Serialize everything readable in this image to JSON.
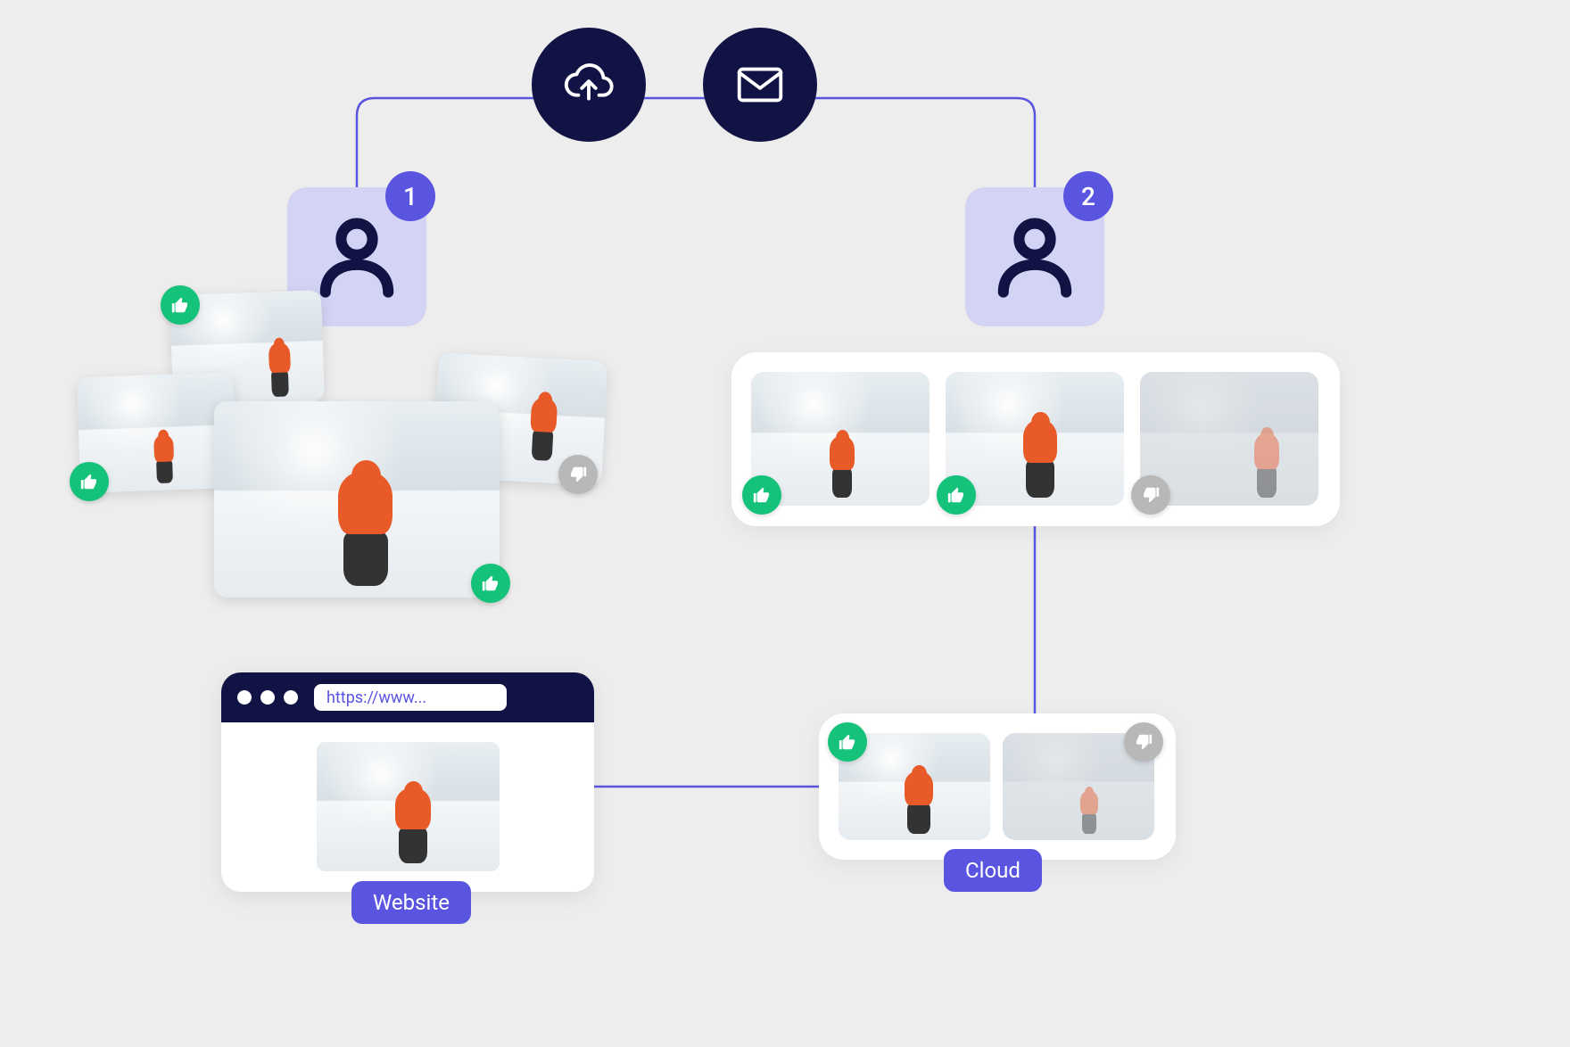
{
  "user1": {
    "badge": "1"
  },
  "user2": {
    "badge": "2"
  },
  "browser": {
    "url": "https://www..."
  },
  "labels": {
    "website": "Website",
    "cloud": "Cloud"
  }
}
